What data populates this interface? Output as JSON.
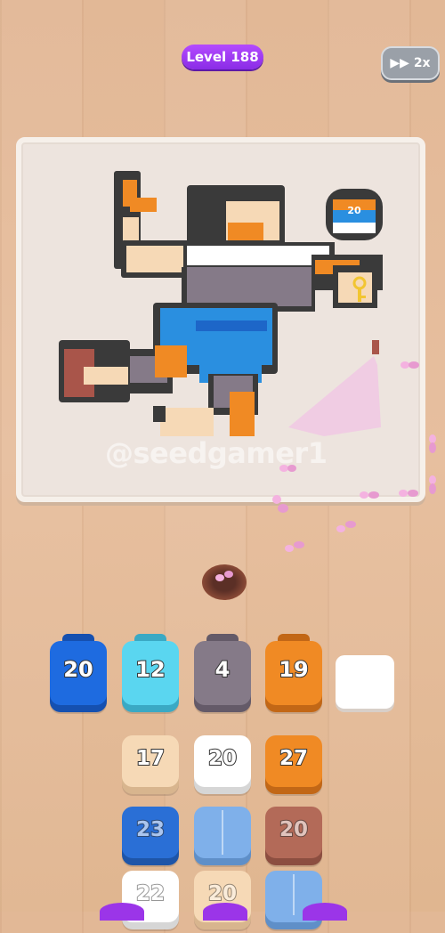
{
  "header": {
    "level_label": "Level 188",
    "speed_label": "2x",
    "speed_icon": "fast-forward-icon"
  },
  "board": {
    "watermark": "@seedgamer1",
    "badge_number": "20",
    "key_icon": "key-icon"
  },
  "queue": [
    {
      "value": "20",
      "color": "#1e6be0",
      "shade": "#1550b0"
    },
    {
      "value": "12",
      "color": "#5ad6f0",
      "shade": "#3aa9c4"
    },
    {
      "value": "4",
      "color": "#857a88",
      "shade": "#645a68"
    },
    {
      "value": "19",
      "color": "#f08a24",
      "shade": "#c26716"
    }
  ],
  "grid": [
    [
      {
        "value": "17",
        "color": "#f6d9b6",
        "shade": "#d8b58e"
      },
      {
        "value": "20",
        "color": "#ffffff",
        "shade": "#d6d6d6"
      },
      {
        "value": "27",
        "color": "#f08a24",
        "shade": "#c26716"
      }
    ],
    [
      {
        "value": "23",
        "color": "#2a6fd6",
        "shade": "#1e55a8"
      },
      {
        "value": "",
        "color": "#7fb0ea",
        "shade": "#5f8fc8"
      },
      {
        "value": "20",
        "color": "#b36a58",
        "shade": "#8c4e40"
      }
    ],
    [
      {
        "value": "22",
        "color": "#ffffff",
        "shade": "#d6d6d6"
      },
      {
        "value": "20",
        "color": "#f6d9b6",
        "shade": "#d8b58e"
      },
      {
        "value": "",
        "color": "#7fb0ea",
        "shade": "#5f8fc8"
      }
    ]
  ]
}
